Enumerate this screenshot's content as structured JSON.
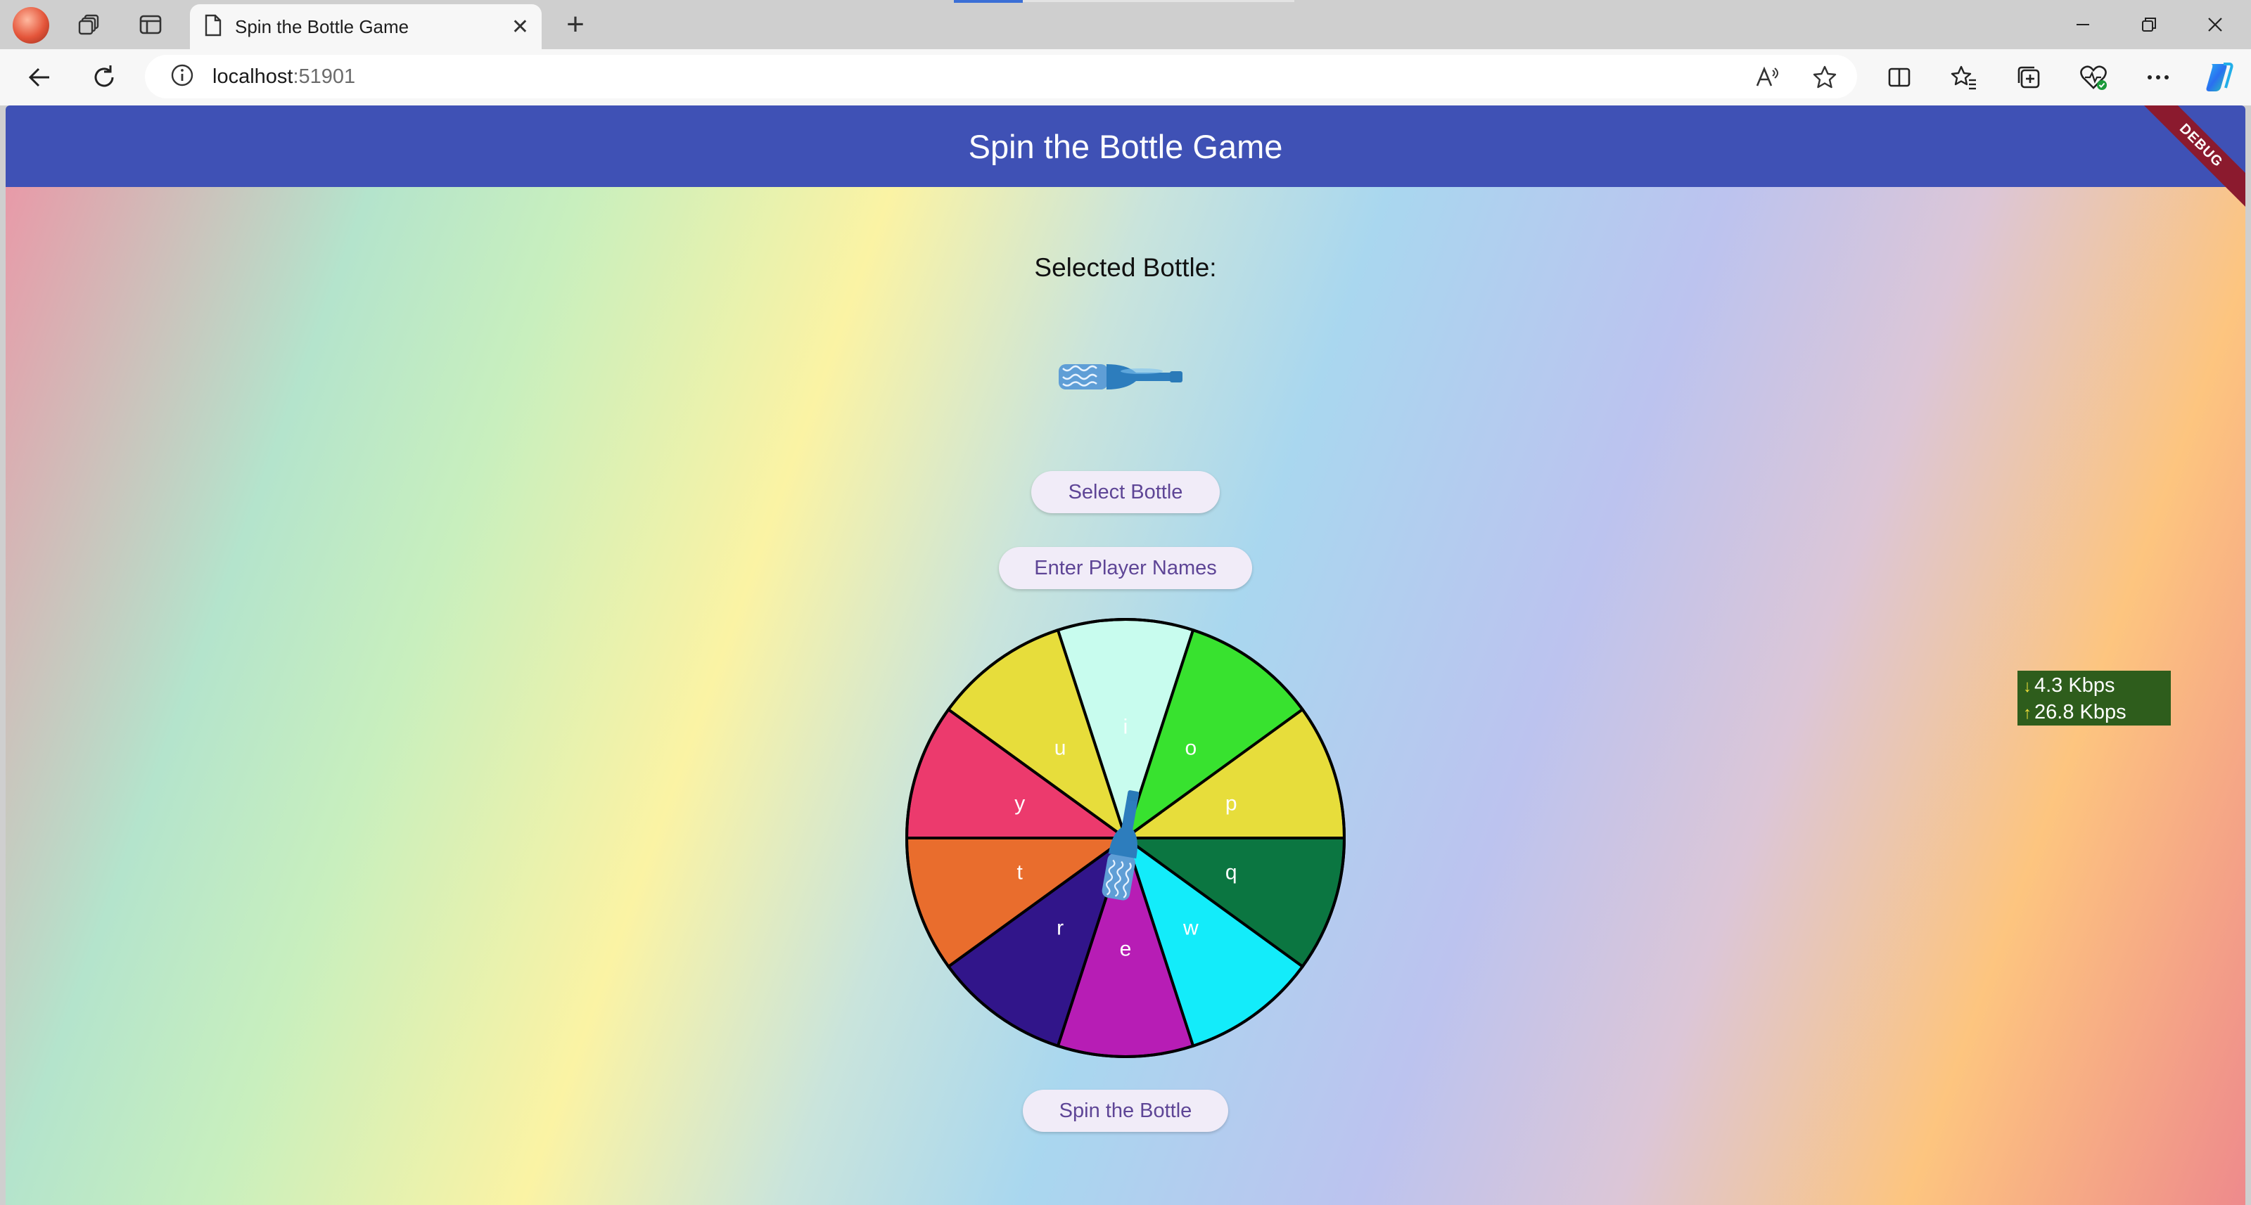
{
  "browser": {
    "tab_title": "Spin the Bottle Game",
    "url_host": "localhost",
    "url_port": ":51901"
  },
  "app": {
    "title": "Spin the Bottle Game",
    "debug_banner": "DEBUG",
    "selected_label": "Selected Bottle:",
    "select_button": "Select Bottle",
    "names_button": "Enter Player Names",
    "spin_button": "Spin the Bottle"
  },
  "wheel": {
    "segments": [
      {
        "label": "i",
        "color": "#c8fcee"
      },
      {
        "label": "o",
        "color": "#38e22f"
      },
      {
        "label": "p",
        "color": "#e7dd3b"
      },
      {
        "label": "q",
        "color": "#0b7641"
      },
      {
        "label": "w",
        "color": "#13ecfa"
      },
      {
        "label": "e",
        "color": "#b71db5"
      },
      {
        "label": "r",
        "color": "#31158a"
      },
      {
        "label": "t",
        "color": "#e96d2d"
      },
      {
        "label": "y",
        "color": "#ec3a6d"
      },
      {
        "label": "u",
        "color": "#e7dd3b"
      }
    ]
  },
  "network_overlay": {
    "download": "4.3 Kbps",
    "upload": "26.8 Kbps"
  },
  "colors": {
    "appbar": "#3f51b5",
    "button_bg": "#f1ecf8",
    "button_text": "#5e4596"
  }
}
